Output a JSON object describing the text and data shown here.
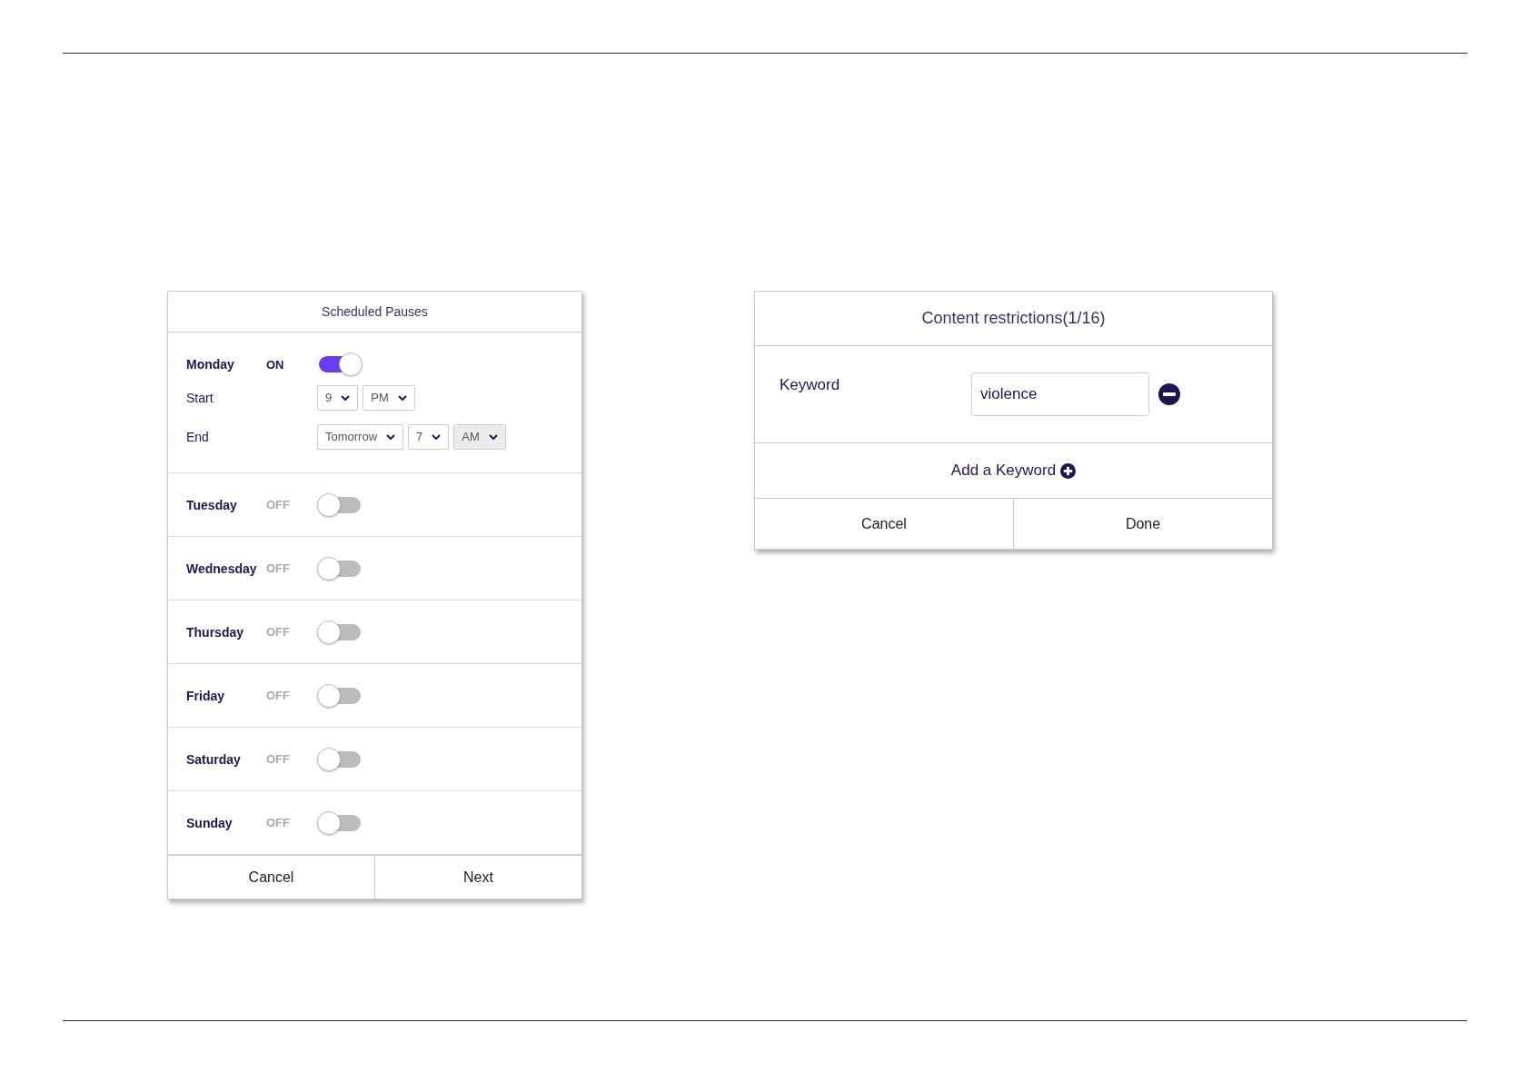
{
  "scheduled_pauses": {
    "title": "Scheduled Pauses",
    "days": [
      {
        "name": "Monday",
        "status": "ON",
        "on": true,
        "times": [
          {
            "label": "Start",
            "selects": [
              {
                "value": "9",
                "disabled": false
              },
              {
                "value": "PM",
                "disabled": false
              }
            ]
          },
          {
            "label": "End",
            "selects": [
              {
                "value": "Tomorrow",
                "disabled": false
              },
              {
                "value": "7",
                "disabled": false
              },
              {
                "value": "AM",
                "disabled": true
              }
            ]
          }
        ]
      },
      {
        "name": "Tuesday",
        "status": "OFF",
        "on": false
      },
      {
        "name": "Wednesday",
        "status": "OFF",
        "on": false
      },
      {
        "name": "Thursday",
        "status": "OFF",
        "on": false
      },
      {
        "name": "Friday",
        "status": "OFF",
        "on": false
      },
      {
        "name": "Saturday",
        "status": "OFF",
        "on": false
      },
      {
        "name": "Sunday",
        "status": "OFF",
        "on": false
      }
    ],
    "buttons": [
      "Cancel",
      "Next"
    ]
  },
  "content_restrictions": {
    "title": "Content restrictions(1/16)",
    "keywords": [
      {
        "label": "Keyword",
        "value": "violence"
      }
    ],
    "add_label": "Add a Keyword",
    "buttons": [
      "Cancel",
      "Done"
    ]
  }
}
